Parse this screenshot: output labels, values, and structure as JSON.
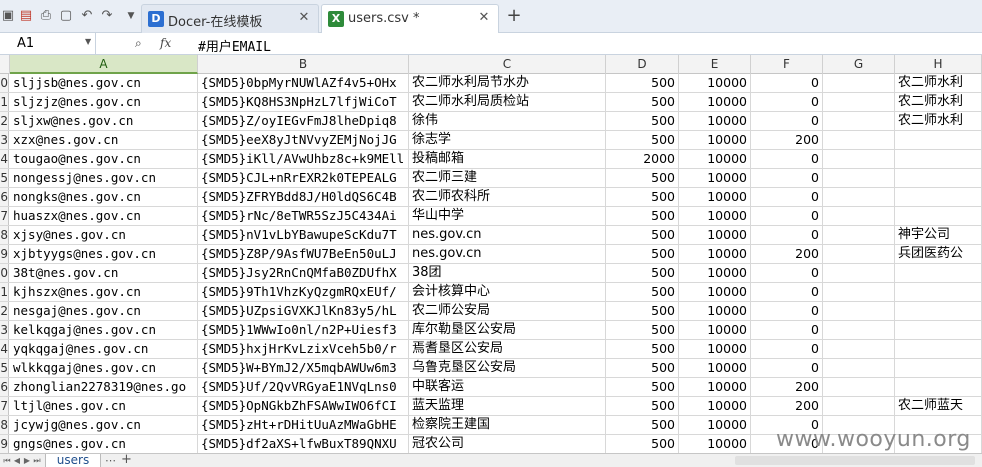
{
  "tabs": [
    {
      "label": "Docer-在线模板"
    },
    {
      "label": "users.csv *"
    }
  ],
  "formula_bar": {
    "cell_ref": "A1",
    "content": "#用户EMAIL"
  },
  "columns": [
    "A",
    "B",
    "C",
    "D",
    "E",
    "F",
    "G",
    "H"
  ],
  "rows": [
    {
      "n": "0",
      "a": "sljjsb@nes.gov.cn",
      "b": "{SMD5}0bpMyrNUWlAZf4v5+OHx",
      "c": "农二师水利局节水办",
      "d": "500",
      "e": "10000",
      "f": "0",
      "g": "",
      "h": "农二师水利"
    },
    {
      "n": "1",
      "a": "sljzjz@nes.gov.cn",
      "b": "{SMD5}KQ8HS3NpHzL7lfjWiCoT",
      "c": "农二师水利局质检站",
      "d": "500",
      "e": "10000",
      "f": "0",
      "g": "",
      "h": "农二师水利"
    },
    {
      "n": "2",
      "a": "sljxw@nes.gov.cn",
      "b": "{SMD5}Z/oyIEGvFmJ8lheDpiq8",
      "c": "徐伟",
      "d": "500",
      "e": "10000",
      "f": "0",
      "g": "",
      "h": "农二师水利"
    },
    {
      "n": "3",
      "a": "xzx@nes.gov.cn",
      "b": "{SMD5}eeX8yJtNVvyZEMjNojJG",
      "c": "徐志学",
      "d": "500",
      "e": "10000",
      "f": "200",
      "g": "",
      "h": ""
    },
    {
      "n": "4",
      "a": "tougao@nes.gov.cn",
      "b": "{SMD5}iKll/AVwUhbz8c+k9MEll",
      "c": "投稿邮箱",
      "d": "2000",
      "e": "10000",
      "f": "0",
      "g": "",
      "h": ""
    },
    {
      "n": "5",
      "a": "nongessj@nes.gov.cn",
      "b": "{SMD5}CJL+nRrEXR2k0TEPEALG",
      "c": "农二师三建",
      "d": "500",
      "e": "10000",
      "f": "0",
      "g": "",
      "h": ""
    },
    {
      "n": "6",
      "a": "nongks@nes.gov.cn",
      "b": "{SMD5}ZFRYBdd8J/H0ldQS6C4B",
      "c": "农二师农科所",
      "d": "500",
      "e": "10000",
      "f": "0",
      "g": "",
      "h": ""
    },
    {
      "n": "7",
      "a": "huaszx@nes.gov.cn",
      "b": "{SMD5}rNc/8eTWR5SzJ5C434Ai",
      "c": "华山中学",
      "d": "500",
      "e": "10000",
      "f": "0",
      "g": "",
      "h": ""
    },
    {
      "n": "8",
      "a": "xjsy@nes.gov.cn",
      "b": "{SMD5}nV1vLbYBawupeScKdu7T",
      "c": "nes.gov.cn",
      "d": "500",
      "e": "10000",
      "f": "0",
      "g": "",
      "h": "神宇公司"
    },
    {
      "n": "9",
      "a": "xjbtyygs@nes.gov.cn",
      "b": "{SMD5}Z8P/9AsfWU7BeEn50uLJ",
      "c": "nes.gov.cn",
      "d": "500",
      "e": "10000",
      "f": "200",
      "g": "",
      "h": "兵团医药公"
    },
    {
      "n": "0",
      "a": "38t@nes.gov.cn",
      "b": "{SMD5}Jsy2RnCnQMfaB0ZDUfhX",
      "c": "38团",
      "d": "500",
      "e": "10000",
      "f": "0",
      "g": "",
      "h": ""
    },
    {
      "n": "1",
      "a": "kjhszx@nes.gov.cn",
      "b": "{SMD5}9Th1VhzKyQzgmRQxEUf/",
      "c": "会计核算中心",
      "d": "500",
      "e": "10000",
      "f": "0",
      "g": "",
      "h": ""
    },
    {
      "n": "2",
      "a": "nesgaj@nes.gov.cn",
      "b": "{SMD5}UZpsiGVXKJlKn83y5/hL",
      "c": "农二师公安局",
      "d": "500",
      "e": "10000",
      "f": "0",
      "g": "",
      "h": ""
    },
    {
      "n": "3",
      "a": "kelkqgaj@nes.gov.cn",
      "b": "{SMD5}1WWwIo0nl/n2P+Uiesf3",
      "c": "库尔勒垦区公安局",
      "d": "500",
      "e": "10000",
      "f": "0",
      "g": "",
      "h": ""
    },
    {
      "n": "4",
      "a": "yqkqgaj@nes.gov.cn",
      "b": "{SMD5}hxjHrKvLzixVceh5b0/r",
      "c": "焉耆垦区公安局",
      "d": "500",
      "e": "10000",
      "f": "0",
      "g": "",
      "h": ""
    },
    {
      "n": "5",
      "a": "wlkkqgaj@nes.gov.cn",
      "b": "{SMD5}W+BYmJ2/X5mqbAWUw6m3",
      "c": "乌鲁克垦区公安局",
      "d": "500",
      "e": "10000",
      "f": "0",
      "g": "",
      "h": ""
    },
    {
      "n": "6",
      "a": "zhonglian2278319@nes.go",
      "b": "{SMD5}Uf/2QvVRGyaE1NVqLns0",
      "c": "中联客运",
      "d": "500",
      "e": "10000",
      "f": "200",
      "g": "",
      "h": ""
    },
    {
      "n": "7",
      "a": "ltjl@nes.gov.cn",
      "b": "{SMD5}OpNGkbZhFSAWwIWO6fCI",
      "c": "蓝天监理",
      "d": "500",
      "e": "10000",
      "f": "200",
      "g": "",
      "h": "农二师蓝天"
    },
    {
      "n": "8",
      "a": "jcywjg@nes.gov.cn",
      "b": "{SMD5}zHt+rDHitUuAzMWaGbHE",
      "c": "检察院王建国",
      "d": "500",
      "e": "10000",
      "f": "0",
      "g": "",
      "h": ""
    },
    {
      "n": "9",
      "a": "gngs@nes.gov.cn",
      "b": "{SMD5}df2aXS+lfwBuxT89QNXU",
      "c": "冠农公司",
      "d": "500",
      "e": "10000",
      "f": "0",
      "g": "",
      "h": ""
    }
  ],
  "sheet_tab": "users",
  "watermark": "www.wooyun.org",
  "colors": {
    "active_col": "#d9e7c6",
    "tab_bar": "#e9eef5",
    "watermark": "#8a8a8a"
  }
}
